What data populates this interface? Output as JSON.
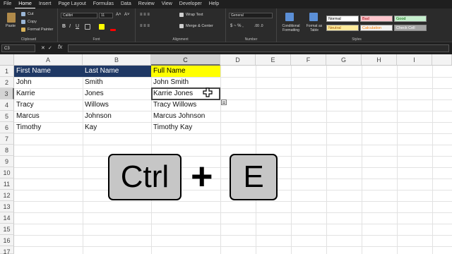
{
  "ribbon": {
    "tabs": [
      "File",
      "Home",
      "Insert",
      "Page Layout",
      "Formulas",
      "Data",
      "Review",
      "View",
      "Developer",
      "Help"
    ],
    "active_tab": "Home",
    "clipboard": {
      "paste": "Paste",
      "cut": "Cut",
      "copy": "Copy",
      "format_painter": "Format Painter",
      "label": "Clipboard"
    },
    "font": {
      "name": "Calibri",
      "size": "11",
      "label": "Font"
    },
    "alignment": {
      "wrap": "Wrap Text",
      "merge": "Merge & Center",
      "label": "Alignment"
    },
    "number": {
      "format": "General",
      "label": "Number"
    },
    "styles": {
      "conditional": "Conditional Formatting",
      "format_table": "Format as Table",
      "cells": [
        {
          "text": "Normal",
          "bg": "#ffffff",
          "color": "#000000"
        },
        {
          "text": "Bad",
          "bg": "#ffc7ce",
          "color": "#9c0006"
        },
        {
          "text": "Good",
          "bg": "#c6efce",
          "color": "#006100"
        },
        {
          "text": "Neutral",
          "bg": "#ffeb9c",
          "color": "#9c5700"
        },
        {
          "text": "Calculation",
          "bg": "#f2f2f2",
          "color": "#fa7d00"
        },
        {
          "text": "Check Cell",
          "bg": "#a5a5a5",
          "color": "#ffffff"
        }
      ],
      "label": "Styles"
    }
  },
  "formula_bar": {
    "name_box": "C3",
    "fx": "fx",
    "value": ""
  },
  "columns": [
    "A",
    "B",
    "C",
    "D",
    "E",
    "F",
    "G",
    "H",
    "I"
  ],
  "rows": [
    "1",
    "2",
    "3",
    "4",
    "5",
    "6",
    "7",
    "8",
    "9",
    "10",
    "11",
    "12",
    "13",
    "14",
    "15",
    "16",
    "17"
  ],
  "sheet": {
    "header": [
      "First Name",
      "Last Name",
      "Full Name"
    ],
    "data": [
      [
        "John",
        "Smith",
        "John Smith"
      ],
      [
        "Karrie",
        "Jones",
        "Karrie Jones"
      ],
      [
        "Tracy",
        "Willows",
        "Tracy Willows"
      ],
      [
        "Marcus",
        "Johnson",
        "Marcus Johnson"
      ],
      [
        "Timothy",
        "Kay",
        "Timothy Kay"
      ]
    ]
  },
  "shortcut": {
    "key1": "Ctrl",
    "plus": "+",
    "key2": "E"
  },
  "colors": {
    "header_fill": "#1f3864",
    "full_name_header_fill": "#ffff00"
  }
}
